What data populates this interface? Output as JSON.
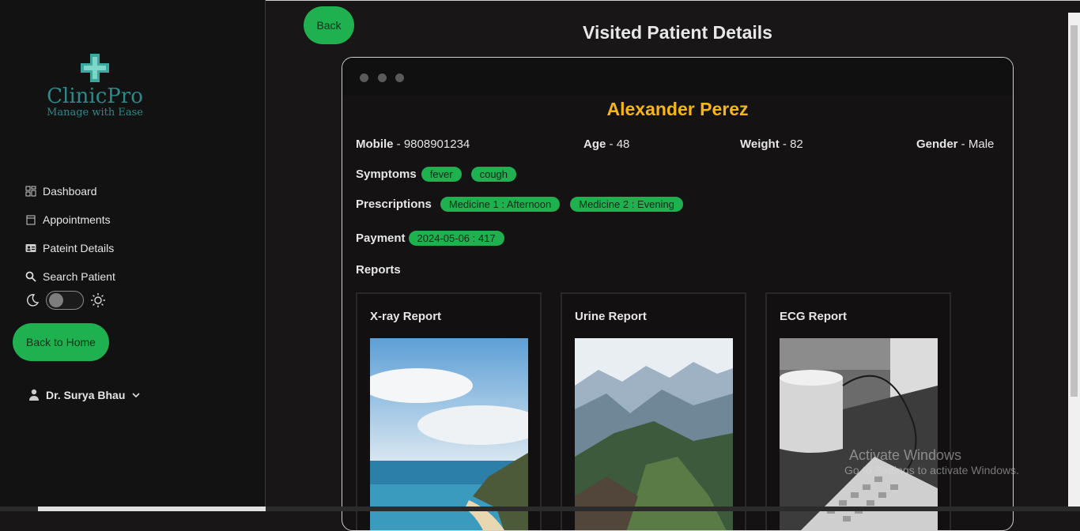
{
  "brand": {
    "name": "ClinicPro",
    "tagline": "Manage with Ease"
  },
  "sidebar": {
    "items": [
      {
        "label": "Dashboard",
        "icon": "dashboard-icon"
      },
      {
        "label": "Appointments",
        "icon": "calendar-icon"
      },
      {
        "label": "Pateint Details",
        "icon": "id-card-icon"
      },
      {
        "label": "Search Patient",
        "icon": "search-icon"
      }
    ],
    "home_button": "Back to Home",
    "user": "Dr. Surya Bhau"
  },
  "header": {
    "back_button": "Back",
    "title": "Visited Patient Details"
  },
  "patient": {
    "name": "Alexander Perez",
    "mobile_label": "Mobile",
    "mobile": "9808901234",
    "age_label": "Age",
    "age": "48",
    "weight_label": "Weight",
    "weight": "82",
    "gender_label": "Gender",
    "gender": "Male",
    "symptoms_label": "Symptoms",
    "symptoms": [
      "fever",
      "cough"
    ],
    "prescriptions_label": "Prescriptions",
    "prescriptions": [
      "Medicine 1 : Afternoon",
      "Medicine 2 : Evening"
    ],
    "payment_label": "Payment",
    "payments": [
      "2024-05-06 : 417"
    ],
    "reports_label": "Reports",
    "reports": [
      {
        "title": "X-ray Report"
      },
      {
        "title": "Urine Report"
      },
      {
        "title": "ECG Report"
      }
    ]
  },
  "watermark": {
    "line1": "Activate Windows",
    "line2": "Go to Settings to activate Windows."
  },
  "colors": {
    "accent": "#1fb050",
    "name": "#f5b514",
    "brand": "#2b8a8a"
  }
}
